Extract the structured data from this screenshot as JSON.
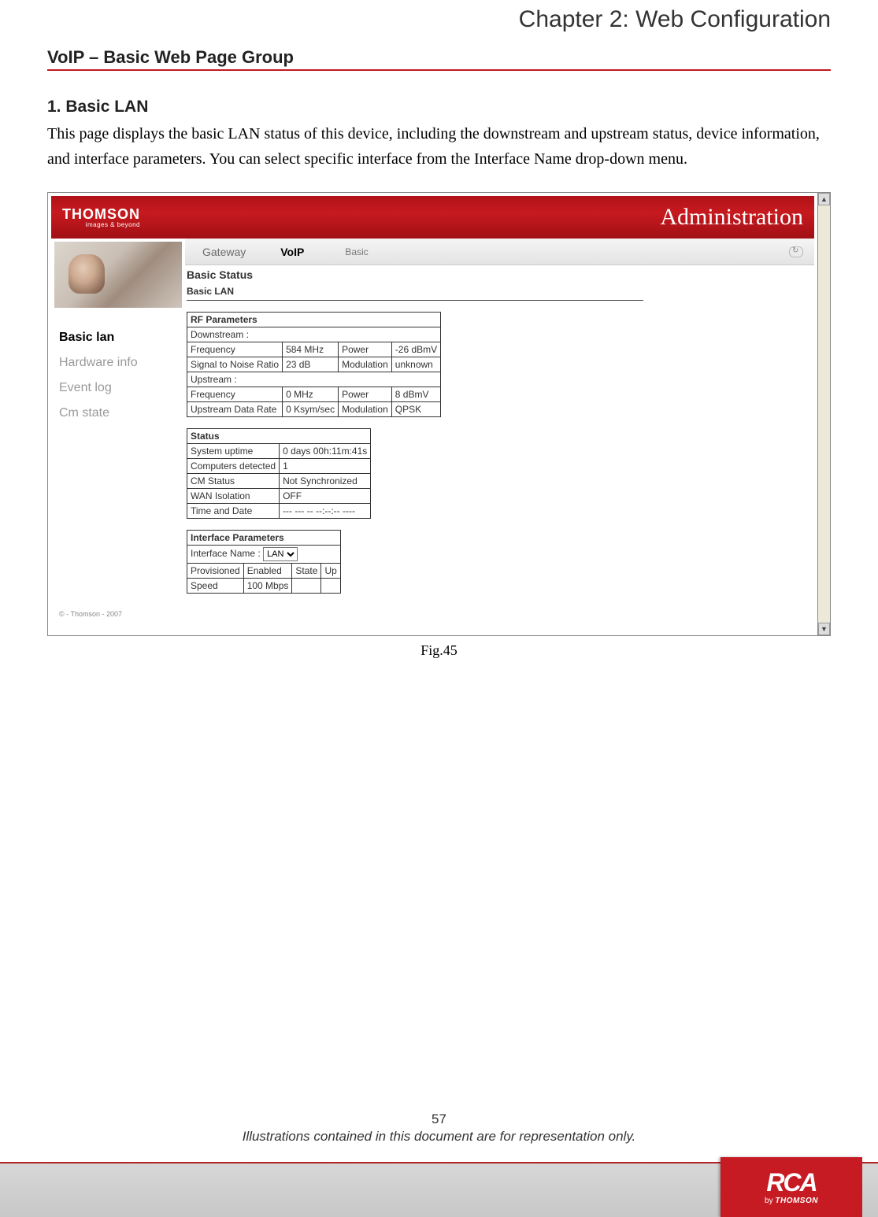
{
  "doc": {
    "chapter_title": "Chapter 2: Web Configuration",
    "section_title": "VoIP – Basic Web Page Group",
    "heading": "1. Basic LAN",
    "body": "This page displays the basic LAN status of this device, including the downstream and upstream status, device information, and interface parameters. You can select specific interface from the Interface Name drop-down menu.",
    "fig_caption": "Fig.45",
    "page_number": "57",
    "footer_note": "Illustrations contained in this document are for representation only."
  },
  "screenshot": {
    "logo_main": "THOMSON",
    "logo_sub": "images & beyond",
    "banner_right": "Administration",
    "tabs": {
      "gateway": "Gateway",
      "voip": "VoIP",
      "sub_basic": "Basic"
    },
    "sidebar": {
      "items": [
        {
          "label": "Basic lan",
          "active": true
        },
        {
          "label": "Hardware info",
          "active": false
        },
        {
          "label": "Event log",
          "active": false
        },
        {
          "label": "Cm state",
          "active": false
        }
      ],
      "copyright": "© - Thomson - 2007"
    },
    "content": {
      "title": "Basic Status",
      "subtitle": "Basic LAN",
      "rf": {
        "header": "RF Parameters",
        "downstream_label": "Downstream :",
        "ds_freq_label": "Frequency",
        "ds_freq_val": "584 MHz",
        "ds_power_label": "Power",
        "ds_power_val": "-26 dBmV",
        "ds_snr_label": "Signal to Noise Ratio",
        "ds_snr_val": "23 dB",
        "ds_mod_label": "Modulation",
        "ds_mod_val": "unknown",
        "upstream_label": "Upstream :",
        "us_freq_label": "Frequency",
        "us_freq_val": "0 MHz",
        "us_power_label": "Power",
        "us_power_val": "8 dBmV",
        "us_rate_label": "Upstream Data Rate",
        "us_rate_val": "0 Ksym/sec",
        "us_mod_label": "Modulation",
        "us_mod_val": "QPSK"
      },
      "status": {
        "header": "Status",
        "uptime_label": "System uptime",
        "uptime_val": "0 days 00h:11m:41s",
        "computers_label": "Computers detected",
        "computers_val": "1",
        "cm_label": "CM Status",
        "cm_val": "Not Synchronized",
        "wan_label": "WAN Isolation",
        "wan_val": "OFF",
        "time_label": "Time and Date",
        "time_val": "--- --- -- --:--:-- ----"
      },
      "iface": {
        "header": "Interface Parameters",
        "name_label": "Interface Name :",
        "name_value": "LAN",
        "prov_label": "Provisioned",
        "prov_val": "Enabled",
        "state_label": "State",
        "state_val": "Up",
        "speed_label": "Speed",
        "speed_val": "100 Mbps"
      }
    }
  },
  "footer_logo": {
    "rca": "RCA",
    "by": "by",
    "thomson": "THOMSON"
  }
}
